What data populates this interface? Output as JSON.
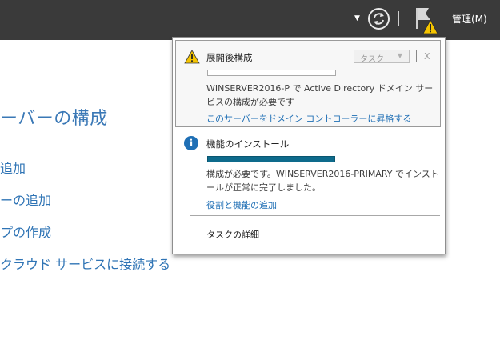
{
  "topbar": {
    "dropdown_arrow": "▼",
    "manage_label": "管理(M)"
  },
  "quickstart": {
    "title": "ーバーの構成",
    "links": [
      "追加",
      "ーの追加",
      "プの作成",
      "クラウド サービスに接続する"
    ]
  },
  "popup": {
    "task1": {
      "title": "展開後構成",
      "task_dropdown": "タスク",
      "close": "X",
      "message": "WINSERVER2016-P で Active Directory ドメイン サービスの構成が必要です",
      "link": "このサーバーをドメイン コントローラーに昇格する",
      "progress": 0
    },
    "task2": {
      "icon_glyph": "i",
      "title": "機能のインストール",
      "message": "構成が必要です。WINSERVER2016-PRIMARY でインストールが正常に完了しました。",
      "link": "役割と機能の追加",
      "progress": 100
    },
    "task_details": "タスクの詳細"
  },
  "colors": {
    "topbar": "#3a3a3a",
    "accent_blue": "#1f6fb5",
    "progress_fill": "#0e6b8c",
    "warning_yellow": "#f5c400"
  }
}
